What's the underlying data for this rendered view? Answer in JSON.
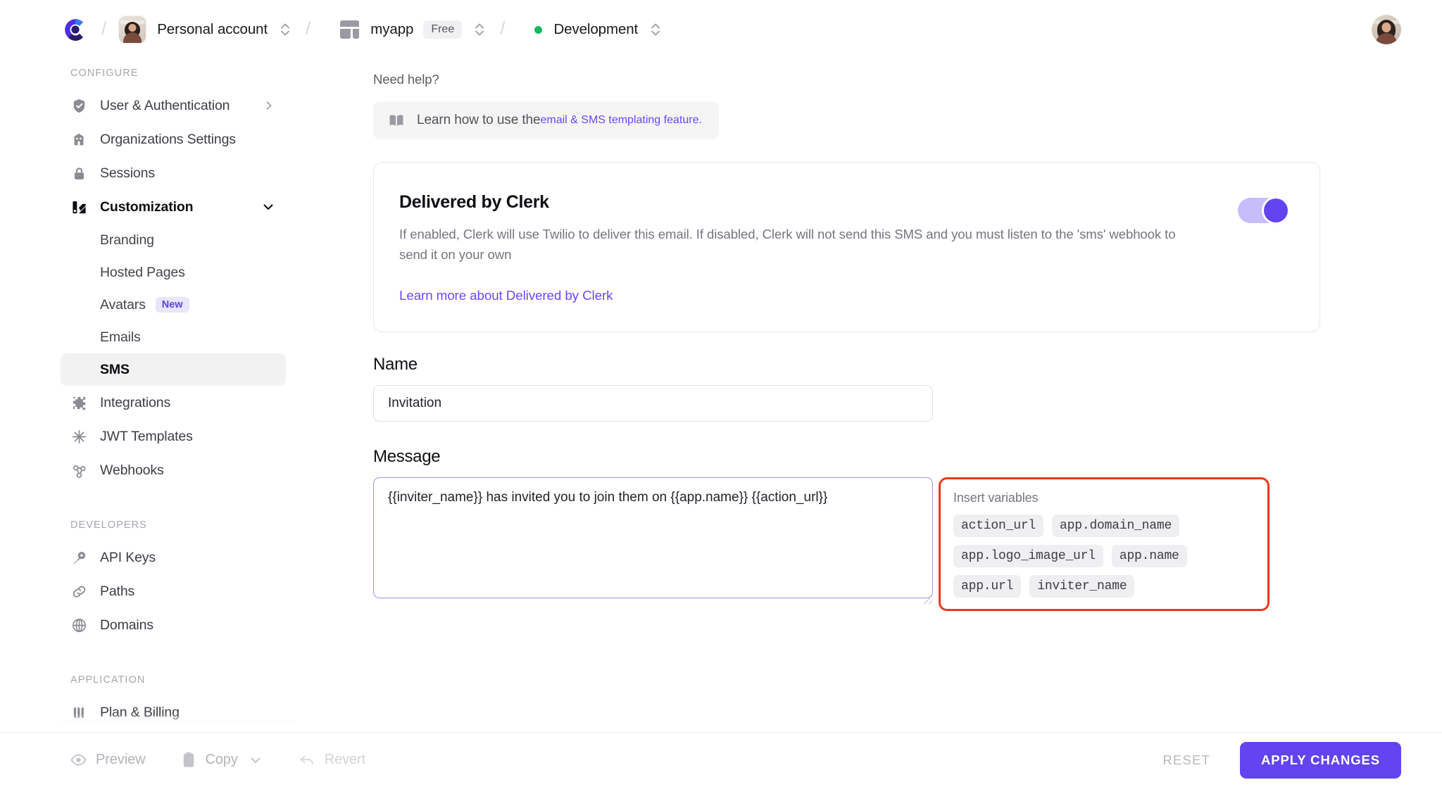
{
  "topbar": {
    "logo_icon": "clerk-logo-icon",
    "separator": "/",
    "account": {
      "avatar_icon": "account-avatar",
      "label": "Personal account",
      "stepper_icon": "chevron-up-down-icon"
    },
    "app": {
      "icon": "app-grid-icon",
      "label": "myapp",
      "plan_badge": "Free",
      "stepper_icon": "chevron-up-down-icon"
    },
    "environment": {
      "status_dot_color": "#18b860",
      "label": "Development",
      "stepper_icon": "chevron-up-down-icon"
    },
    "user_avatar_icon": "user-avatar"
  },
  "sidebar": {
    "sections": [
      {
        "title": "CONFIGURE",
        "items": [
          {
            "label": "User & Authentication",
            "icon": "shield-check-icon",
            "chevron": "chevron-right-icon",
            "active": false,
            "bold": false
          },
          {
            "label": "Organizations Settings",
            "icon": "building-icon",
            "active": false,
            "bold": false
          },
          {
            "label": "Sessions",
            "icon": "lock-icon",
            "active": false,
            "bold": false
          },
          {
            "label": "Customization",
            "icon": "customization-icon",
            "chevron": "chevron-down-icon",
            "active": false,
            "bold": true
          }
        ],
        "sub_items": [
          {
            "label": "Branding",
            "active": false
          },
          {
            "label": "Hosted Pages",
            "active": false
          },
          {
            "label": "Avatars",
            "badge": "New",
            "active": false
          },
          {
            "label": "Emails",
            "active": false
          },
          {
            "label": "SMS",
            "active": true
          }
        ],
        "items_after": [
          {
            "label": "Integrations",
            "icon": "puzzle-icon",
            "active": false
          },
          {
            "label": "JWT Templates",
            "icon": "asterisk-icon",
            "active": false
          },
          {
            "label": "Webhooks",
            "icon": "webhook-icon",
            "active": false
          }
        ]
      },
      {
        "title": "DEVELOPERS",
        "items": [
          {
            "label": "API Keys",
            "icon": "key-icon",
            "active": false
          },
          {
            "label": "Paths",
            "icon": "link-icon",
            "active": false
          },
          {
            "label": "Domains",
            "icon": "globe-icon",
            "active": false
          }
        ]
      },
      {
        "title": "APPLICATION",
        "items": [
          {
            "label": "Plan & Billing",
            "icon": "billing-icon",
            "active": false
          }
        ]
      }
    ]
  },
  "main": {
    "need_help": "Need help?",
    "help_banner": {
      "icon": "book-icon",
      "text_before": "Learn how to use the ",
      "link_text": "email & SMS templating feature."
    },
    "delivered_card": {
      "title": "Delivered by Clerk",
      "description": "If enabled, Clerk will use Twilio to deliver this email. If disabled, Clerk will not send this SMS and you must listen to the 'sms' webhook to send it on your own",
      "link": "Learn more about Delivered by Clerk",
      "toggle_on": true,
      "toggle_track_color": "#c7bdfb",
      "toggle_knob_color": "#6244f0"
    },
    "name_field": {
      "label": "Name",
      "value": "Invitation",
      "placeholder": "Name"
    },
    "message_field": {
      "label": "Message",
      "value": "{{inviter_name}} has invited you to join them on {{app.name}} {{action_url}}",
      "placeholder": "Message",
      "focused": true,
      "border_color": "#a291ea"
    },
    "insert_variables": {
      "title": "Insert variables",
      "highlight_color": "#e8381a",
      "chips": [
        "action_url",
        "app.domain_name",
        "app.logo_image_url",
        "app.name",
        "app.url",
        "inviter_name"
      ]
    }
  },
  "bottombar": {
    "preview": {
      "label": "Preview",
      "icon": "eye-icon"
    },
    "copy": {
      "label": "Copy",
      "icon": "clipboard-icon",
      "caret": "chevron-down-icon"
    },
    "revert": {
      "label": "Revert",
      "icon": "undo-arrow-icon"
    },
    "reset_label": "RESET",
    "apply_label": "APPLY CHANGES",
    "apply_color": "#6244f0"
  }
}
